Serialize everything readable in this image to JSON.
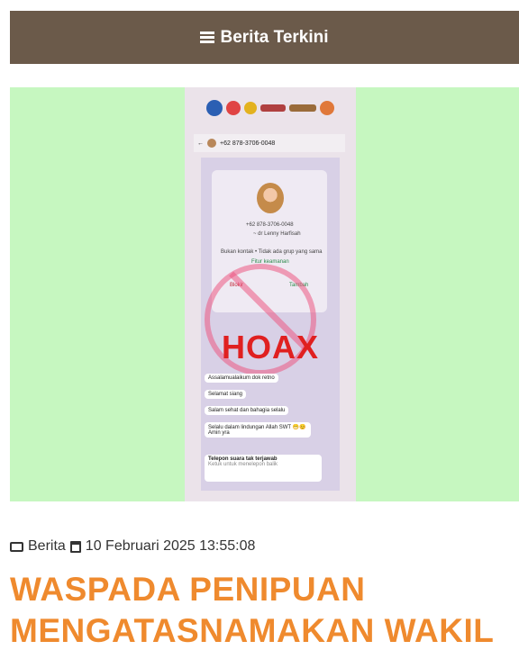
{
  "header": {
    "title": "Berita Terkini",
    "icon": "list-icon"
  },
  "banner": {
    "phone_number": "+62 878-3706-0048",
    "contact_sub": "~ dr Lenny Harfisah",
    "note": "Bukan kontak • Tidak ada grup yang sama",
    "safety_tip": "Fitur keamanan",
    "block": "Blokir",
    "add": "Tambah",
    "stamp": "HOAX",
    "messages": [
      "Assalamualaikum dok retno",
      "Selamat siang",
      "Salam sehat dan bahagia selalu",
      "Selalu dalam lindungan Allah SWT 😁😊 Amin yra"
    ],
    "call_title": "Telepon suara tak terjawab",
    "call_sub": "Ketuk untuk menelepon balik",
    "colors": {
      "background": "#c6f7c0",
      "stamp": "#e02020"
    }
  },
  "meta": {
    "category": "Berita",
    "date": "10 Februari 2025 13:55:08"
  },
  "article": {
    "title": "WASPADA PENIPUAN MENGATASNAMAKAN WAKIL"
  },
  "colors": {
    "header": "#6b5a4a",
    "title": "#ef8a2e"
  }
}
